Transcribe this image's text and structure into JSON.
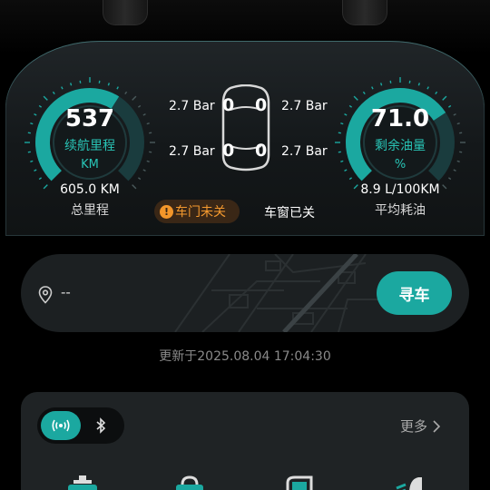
{
  "gauges": {
    "range": {
      "value": "537",
      "label": "续航里程",
      "unit": "KM",
      "fill_fraction": 0.62
    },
    "fuel": {
      "value": "71.0",
      "label": "剩余油量",
      "unit": "%",
      "fill_fraction": 0.71
    }
  },
  "stats": {
    "total_mileage_value": "605.0 KM",
    "total_mileage_label": "总里程",
    "avg_fuel_value": "8.9 L/100KM",
    "avg_fuel_label": "平均耗油"
  },
  "tires": {
    "front_left": "2.7 Bar",
    "front_right": "2.7 Bar",
    "rear_left": "2.7 Bar",
    "rear_right": "2.7 Bar",
    "door_front_left": "0",
    "door_front_right": "0",
    "door_rear_left": "0",
    "door_rear_right": "0"
  },
  "status": {
    "door": "车门未关",
    "window": "车窗已关"
  },
  "location": {
    "address": "--",
    "find_label": "寻车"
  },
  "updated_text": "更新于2025.08.04 17:04:30",
  "controls": {
    "more_label": "更多"
  },
  "colors": {
    "accent": "#1ba8a0",
    "warning": "#f59a2f"
  }
}
